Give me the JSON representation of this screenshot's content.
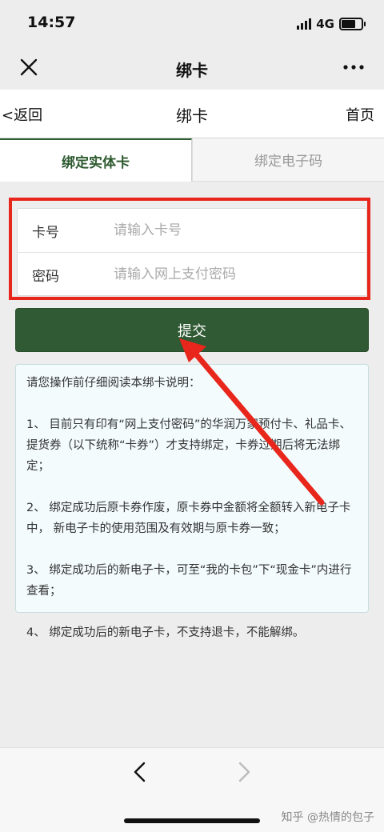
{
  "status_bar": {
    "time": "14:57",
    "network": "4G"
  },
  "wechat_bar": {
    "title": "绑卡"
  },
  "page_header": {
    "back_label": "<返回",
    "title": "绑卡",
    "home_label": "首页"
  },
  "tabs": [
    {
      "label": "绑定实体卡",
      "active": true
    },
    {
      "label": "绑定电子码",
      "active": false
    }
  ],
  "form": {
    "card_number": {
      "label": "卡号",
      "placeholder": "请输入卡号",
      "value": ""
    },
    "password": {
      "label": "密码",
      "placeholder": "请输入网上支付密码",
      "value": ""
    }
  },
  "submit_label": "提交",
  "notice": {
    "paragraphs": [
      "请您操作前仔细阅读本绑卡说明：",
      "1、 目前只有印有“网上支付密码”的华润万家预付卡、礼品卡、提货券（以下统称“卡券”）才支持绑定，卡券过期后将无法绑定；",
      "2、 绑定成功后原卡券作废，原卡券中金额将全额转入新电子卡中， 新电子卡的使用范围及有效期与原卡券一致；",
      "3、 绑定成功后的新电子卡，可至“我的卡包”下“现金卡”内进行查看；",
      "4、 绑定成功后的新电子卡，不支持退卡，不能解绑。"
    ]
  },
  "watermark": "知乎 @热情的包子",
  "colors": {
    "accent": "#305a33",
    "highlight": "#e8261c",
    "arrow": "#e8261c"
  }
}
